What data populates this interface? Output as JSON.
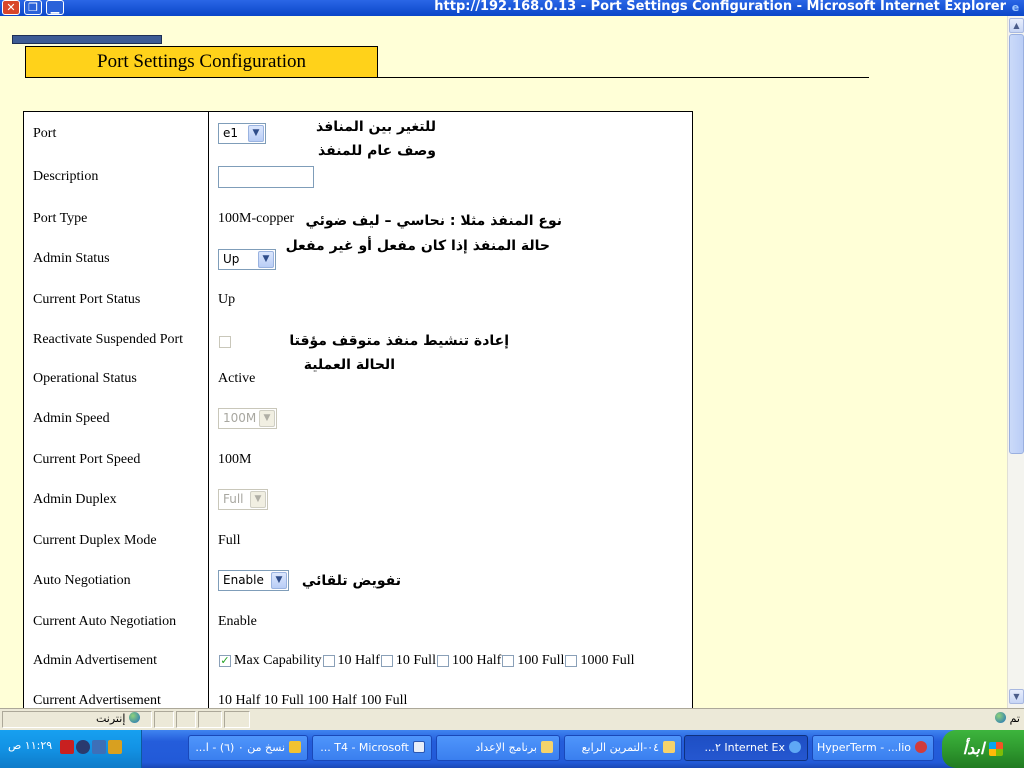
{
  "window": {
    "title": "http://192.168.0.13 - Port Settings Configuration - Microsoft Internet Explorer"
  },
  "page": {
    "header_title": "Port Settings Configuration"
  },
  "form": {
    "port": {
      "label": "Port",
      "value": "e1"
    },
    "description": {
      "label": "Description",
      "value": ""
    },
    "port_type": {
      "label": "Port Type",
      "value": "100M-copper"
    },
    "admin_status": {
      "label": "Admin Status",
      "value": "Up"
    },
    "current_port_status": {
      "label": "Current Port Status",
      "value": "Up"
    },
    "reactivate": {
      "label": "Reactivate Suspended Port"
    },
    "operational_status": {
      "label": "Operational Status",
      "value": "Active"
    },
    "admin_speed": {
      "label": "Admin Speed",
      "value": "100M"
    },
    "current_port_speed": {
      "label": "Current Port Speed",
      "value": "100M"
    },
    "admin_duplex": {
      "label": "Admin Duplex",
      "value": "Full"
    },
    "current_duplex_mode": {
      "label": "Current Duplex Mode",
      "value": "Full"
    },
    "auto_negotiation": {
      "label": "Auto Negotiation",
      "value": "Enable"
    },
    "current_auto_negotiation": {
      "label": "Current Auto Negotiation",
      "value": "Enable"
    },
    "admin_advertisement": {
      "label": "Admin Advertisement",
      "options": [
        "Max Capability",
        "10 Half",
        "10 Full",
        "100 Half",
        "100 Full",
        "1000 Full"
      ],
      "checked": [
        true,
        false,
        false,
        false,
        false,
        false
      ]
    },
    "current_advertisement": {
      "label": "Current Advertisement",
      "value": "10 Half 10 Full 100 Half 100 Full"
    }
  },
  "annotations": {
    "port": "للتغير بين المنافذ",
    "description": "وصف عام للمنفذ",
    "port_type": "نوع المنفذ مثلا : نحاسي – ليف ضوئي",
    "admin_status": "حالة المنفذ إذا كان مفعل أو غير مفعل",
    "reactivate": "إعادة تنشيط منفذ متوقف مؤقتا",
    "operational_status": "الحالة العملية",
    "auto_negotiation": "تفويض تلقائي"
  },
  "statusbar": {
    "zone": "إنترنت",
    "done": "تم"
  },
  "taskbar": {
    "start_label": "ابدأ",
    "clock": "١١:٢٩ ص",
    "tasks": [
      "HyperTerm - ...lio",
      "Internet Ex ٢...",
      "٠٤-التمرين الرابع",
      "برنامج الإعداد",
      "T4 - Microsoft ...",
      "نسخ من ٠ (٦) - ا..."
    ]
  },
  "colors": {
    "page_bg": "#ffffd7",
    "header_bg": "#ffd21a",
    "title_bar": "#0a46c8",
    "taskbar": "#245ddb"
  }
}
